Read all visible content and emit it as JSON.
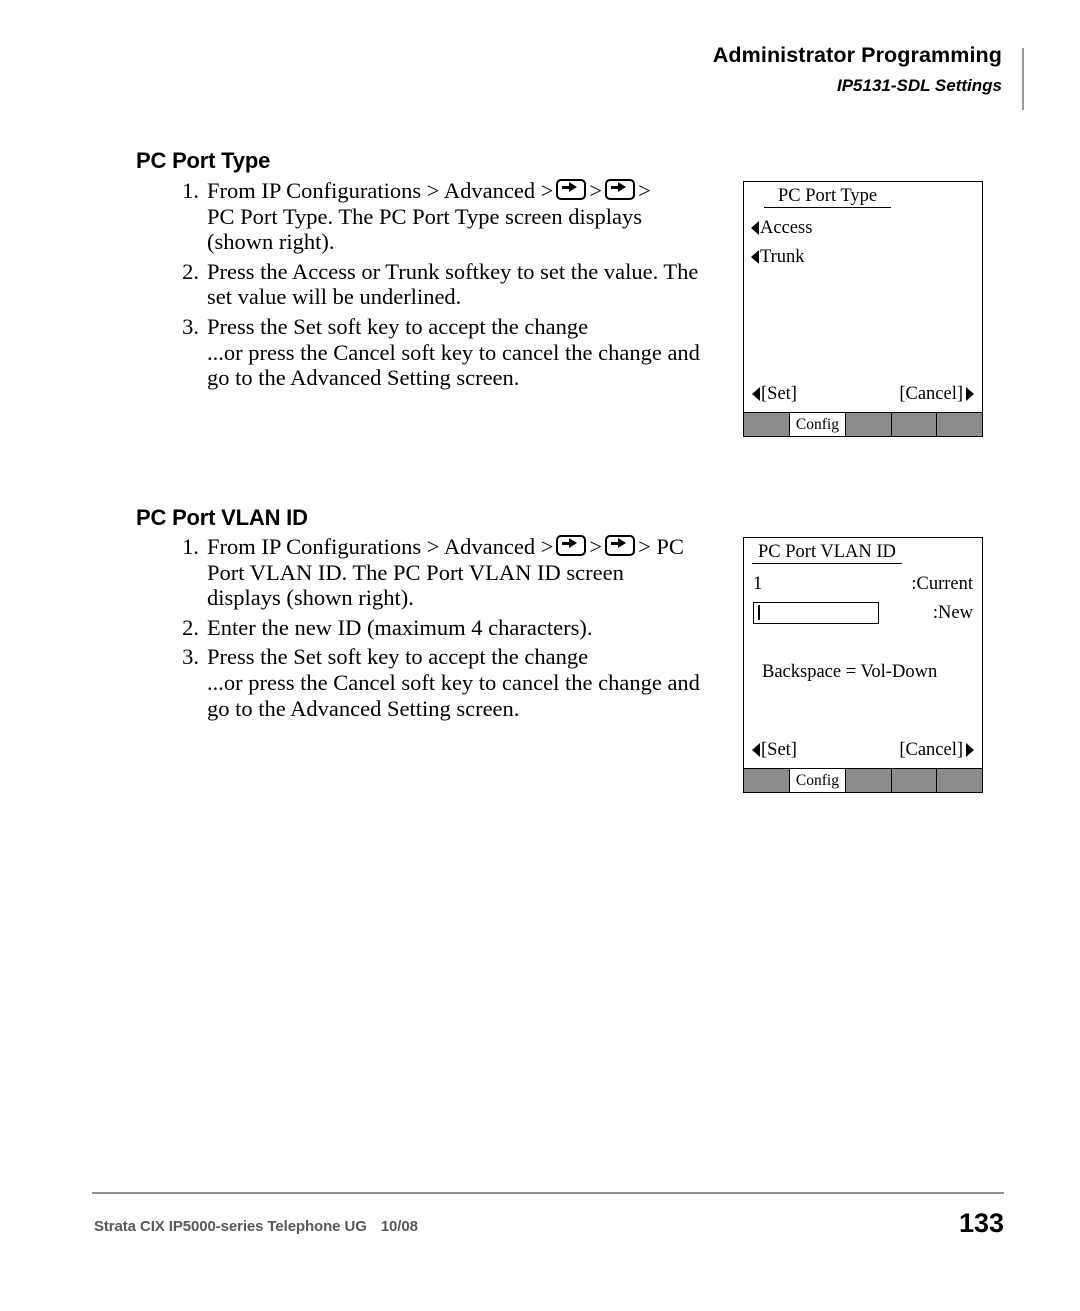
{
  "header": {
    "title": "Administrator Programming",
    "subtitle": "IP5131-SDL Settings"
  },
  "sections": [
    {
      "heading": "PC Port Type",
      "steps": [
        {
          "num": "1.",
          "lines": [
            {
              "pre": "From IP Configurations > Advanced >",
              "icon1": true,
              "mid": ">",
              "icon2": true,
              "post": ">"
            },
            {
              "text": "PC Port Type. The PC Port Type screen displays"
            },
            {
              "text": "(shown right)."
            }
          ]
        },
        {
          "num": "2.",
          "lines": [
            {
              "text": "Press the Access or Trunk softkey to set the value. The"
            },
            {
              "text": "set value will be underlined."
            }
          ]
        },
        {
          "num": "3.",
          "lines": [
            {
              "text": "Press the Set soft key to accept the change"
            },
            {
              "text": "...or press the Cancel soft key to cancel the change and"
            },
            {
              "text": "go to the Advanced Setting screen."
            }
          ]
        }
      ]
    },
    {
      "heading": "PC Port VLAN ID",
      "steps": [
        {
          "num": "1.",
          "lines": [
            {
              "pre": "From IP Configurations > Advanced >",
              "icon1": true,
              "mid": ">",
              "icon2": true,
              "post": "> PC"
            },
            {
              "text": "Port VLAN ID. The PC Port VLAN ID screen"
            },
            {
              "text": "displays (shown right)."
            }
          ]
        },
        {
          "num": "2.",
          "lines": [
            {
              "text": "Enter the new ID (maximum 4 characters)."
            }
          ]
        },
        {
          "num": "3.",
          "lines": [
            {
              "text": "Press the Set soft key to accept the change"
            },
            {
              "text": "...or press the Cancel soft key to cancel the change and"
            },
            {
              "text": "go to the Advanced Setting screen."
            }
          ]
        }
      ]
    }
  ],
  "screen1": {
    "title": "PC Port Type",
    "menu_items": [
      "Access",
      "Trunk"
    ],
    "softkey_left": "[Set]",
    "softkey_right": "[Cancel]",
    "tabs": [
      "",
      "Config",
      "",
      "",
      ""
    ],
    "active_tab": "Config"
  },
  "screen2": {
    "title": "PC Port VLAN ID",
    "current_value": "1",
    "current_label": ":Current",
    "new_value": "",
    "new_label": ":New",
    "hint": "Backspace = Vol-Down",
    "softkey_left": "[Set]",
    "softkey_right": "[Cancel]",
    "tabs": [
      "",
      "Config",
      "",
      "",
      ""
    ],
    "active_tab": "Config"
  },
  "footer": {
    "doc_title": "Strata CIX IP5000-series Telephone UG",
    "date": "10/08",
    "page_number": "133"
  }
}
